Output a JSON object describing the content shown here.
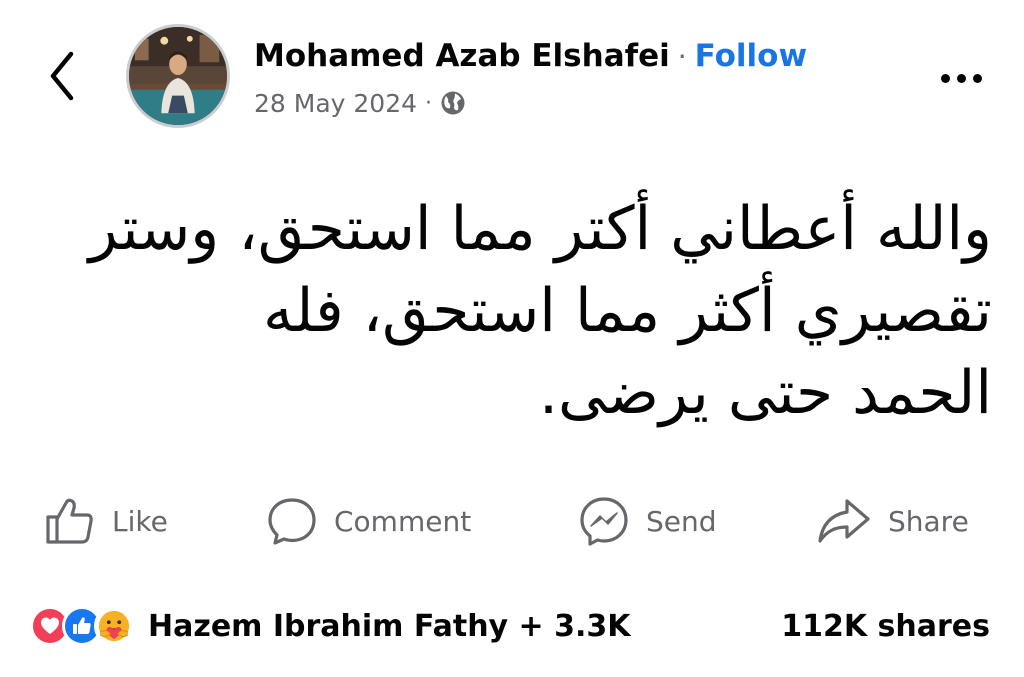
{
  "post": {
    "author": {
      "name": "Mohamed Azab Elshafei",
      "separator": "·",
      "follow_label": "Follow"
    },
    "meta": {
      "date": "28 May 2024",
      "separator": "·",
      "privacy_icon": "globe-icon"
    },
    "text_lines": [
      "والله أعطاني أكتر مما استحق، وستر",
      "تقصيري أكثر مما استحق، فله",
      "الحمد حتى يرضى."
    ]
  },
  "actions": {
    "like": "Like",
    "comment": "Comment",
    "send": "Send",
    "share": "Share"
  },
  "reactions": {
    "icons": [
      "love-icon",
      "like-icon",
      "care-icon"
    ],
    "summary": "Hazem Ibrahim Fathy + 3.3K",
    "shares": "112K shares"
  },
  "colors": {
    "follow": "#1b74e4",
    "secondary_text": "#65676b",
    "love": "#f33e58",
    "like": "#1877f2"
  }
}
